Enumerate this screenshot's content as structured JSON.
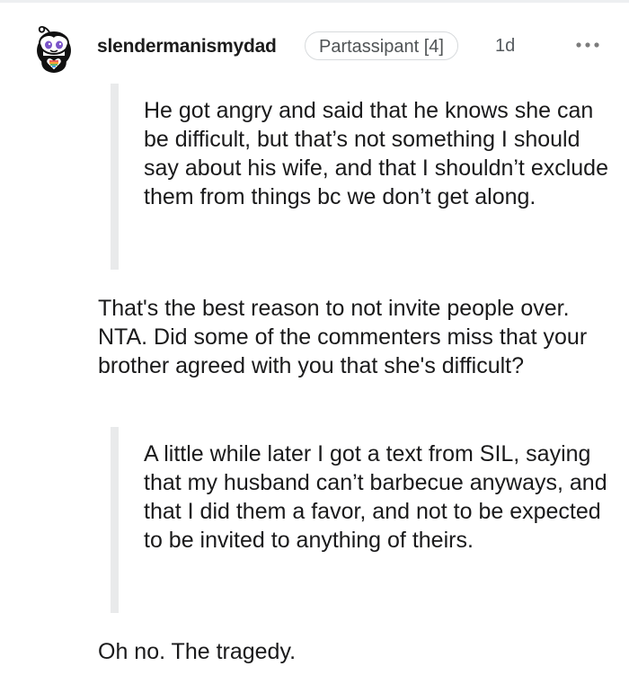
{
  "comment": {
    "username": "slendermanismydad",
    "flair": "Partassipant [4]",
    "age": "1d",
    "more_icon": "more-horizontal-icon",
    "avatar_icon": "snoo-avatar-icon",
    "quote_1": "He got angry and said that he knows she can be difficult, but that’s not something I should say about his wife, and that I shouldn’t exclude them from things bc we don’t get along.",
    "reply_1": "That's the best reason to not invite people over. NTA. Did some of the commenters miss that your brother agreed with you that she's difficult?",
    "quote_2": "A little while later I got a text from SIL, saying that my husband can’t barbecue anyways, and that I did them a favor, and not to be expected to be invited to anything of theirs.",
    "reply_2": "Oh no. The tragedy."
  },
  "colors": {
    "quote_bar": "#e9eaeb",
    "text": "#1a1a1b",
    "meta": "#555a5e",
    "flair_border": "#d7dadc"
  }
}
